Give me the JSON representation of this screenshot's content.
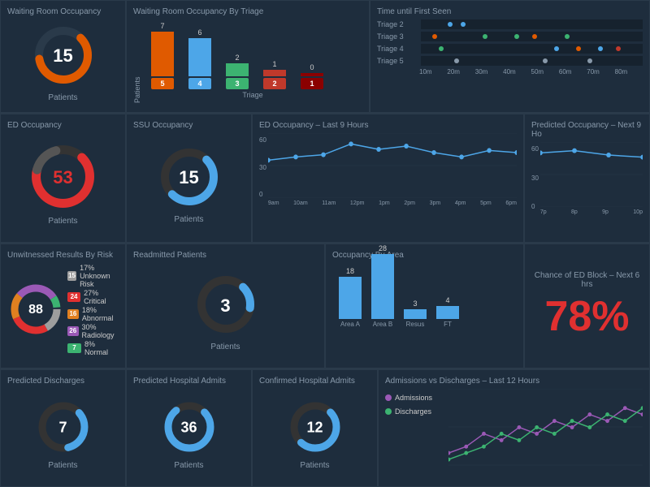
{
  "row1": {
    "waiting_room": {
      "title": "Waiting Room Occupancy",
      "value": 15,
      "label": "Patients"
    },
    "triage": {
      "title": "Waiting Room Occupancy By Triage",
      "bars": [
        {
          "label": "5",
          "value": 7,
          "color": "#e05a00",
          "badge_color": "#e05a00"
        },
        {
          "label": "4",
          "value": 6,
          "color": "#4da6e8",
          "badge_color": "#4da6e8"
        },
        {
          "label": "3",
          "value": 2,
          "color": "#3cb371",
          "badge_color": "#3cb371"
        },
        {
          "label": "2",
          "value": 1,
          "color": "#c0392b",
          "badge_color": "#c0392b"
        },
        {
          "label": "1",
          "value": 0,
          "color": "#8b0000",
          "badge_color": "#8b0000"
        }
      ],
      "y_label": "Patients",
      "x_label": "Triage"
    },
    "time_first_seen": {
      "title": "Time until First Seen",
      "rows": [
        {
          "label": "Triage 2",
          "dots": [
            {
              "pos": 12,
              "color": "#4da6e8"
            },
            {
              "pos": 18,
              "color": "#4da6e8"
            }
          ]
        },
        {
          "label": "Triage 3",
          "dots": [
            {
              "pos": 5,
              "color": "#e05a00"
            },
            {
              "pos": 28,
              "color": "#3cb371"
            },
            {
              "pos": 42,
              "color": "#3cb371"
            },
            {
              "pos": 50,
              "color": "#e05a00"
            },
            {
              "pos": 65,
              "color": "#3cb371"
            }
          ]
        },
        {
          "label": "Triage 4",
          "dots": [
            {
              "pos": 8,
              "color": "#3cb371"
            },
            {
              "pos": 60,
              "color": "#4da6e8"
            },
            {
              "pos": 70,
              "color": "#e05a00"
            },
            {
              "pos": 80,
              "color": "#4da6e8"
            },
            {
              "pos": 88,
              "color": "#c0392b"
            }
          ]
        },
        {
          "label": "Triage 5",
          "dots": [
            {
              "pos": 15,
              "color": "#8899aa"
            },
            {
              "pos": 55,
              "color": "#8899aa"
            },
            {
              "pos": 75,
              "color": "#8899aa"
            }
          ]
        }
      ],
      "x_ticks": [
        "10m",
        "20m",
        "30m",
        "40m",
        "50m",
        "60m",
        "70m",
        "80m"
      ]
    }
  },
  "row2": {
    "ed_occupancy": {
      "title": "ED Occupancy",
      "value": 53,
      "label": "Patients",
      "color": "#e03030"
    },
    "ssu_occupancy": {
      "title": "SSU Occupancy",
      "value": 15,
      "label": "Patients",
      "color": "#4da6e8"
    },
    "ed_last9": {
      "title": "ED Occupancy – Last 9 Hours",
      "y_ticks": [
        "60",
        "30",
        "0"
      ],
      "x_ticks": [
        "9am",
        "10am",
        "11am",
        "12pm",
        "1pm",
        "2pm",
        "3pm",
        "4pm",
        "5pm",
        "6pm"
      ],
      "points": [
        35,
        38,
        40,
        50,
        45,
        48,
        42,
        38,
        44,
        42
      ]
    },
    "predicted_next9": {
      "title": "Predicted Occupancy – Next 9 Ho",
      "y_ticks": [
        "60",
        "30",
        "0"
      ],
      "x_ticks": [
        "7p",
        "8p",
        "9p",
        "10p"
      ],
      "points": [
        50,
        52,
        48,
        46
      ]
    }
  },
  "row3": {
    "unwitnessed": {
      "title": "Unwitnessed Results By Risk",
      "value": 88,
      "legend": [
        {
          "count": 15,
          "pct": "17% Unknown Risk",
          "color": "#9e9e9e",
          "badge_color": "#9e9e9e"
        },
        {
          "count": 24,
          "pct": "27% Critical",
          "color": "#e03030",
          "badge_color": "#e03030"
        },
        {
          "count": 16,
          "pct": "18% Abnormal",
          "color": "#e08020",
          "badge_color": "#e08020"
        },
        {
          "count": 26,
          "pct": "30% Radiology",
          "color": "#9b59b6",
          "badge_color": "#9b59b6"
        },
        {
          "count": 7,
          "pct": "8% Normal",
          "color": "#3cb371",
          "badge_color": "#3cb371"
        }
      ]
    },
    "readmitted": {
      "title": "Readmitted Patients",
      "value": 3,
      "label": "Patients"
    },
    "occupancy_area": {
      "title": "Occupancy By Area",
      "bars": [
        {
          "label": "Area A",
          "value": 18,
          "height": 52
        },
        {
          "label": "Area B",
          "value": 28,
          "height": 80
        },
        {
          "label": "Resus",
          "value": 3,
          "height": 12
        },
        {
          "label": "FT",
          "value": 4,
          "height": 16
        }
      ]
    },
    "ed_block": {
      "title": "Chance of ED Block – Next 6 hrs",
      "value": "78%"
    }
  },
  "row4": {
    "predicted_discharges": {
      "title": "Predicted Discharges",
      "value": 7,
      "label": "Patients"
    },
    "predicted_admits": {
      "title": "Predicted Hospital Admits",
      "value": 36,
      "label": "Patients"
    },
    "confirmed_admits": {
      "title": "Confirmed Hospital Admits",
      "value": 12,
      "label": "Patients"
    },
    "adm_vs_dis": {
      "title": "Admissions vs Discharges – Last 12 Hours",
      "legend": [
        {
          "label": "Admissions",
          "color": "#9b59b6"
        },
        {
          "label": "Discharges",
          "color": "#3cb371"
        }
      ],
      "admissions": [
        2,
        3,
        5,
        4,
        6,
        5,
        7,
        6,
        8,
        7,
        9,
        8
      ],
      "discharges": [
        1,
        2,
        3,
        5,
        4,
        6,
        5,
        7,
        6,
        8,
        7,
        9
      ]
    }
  }
}
